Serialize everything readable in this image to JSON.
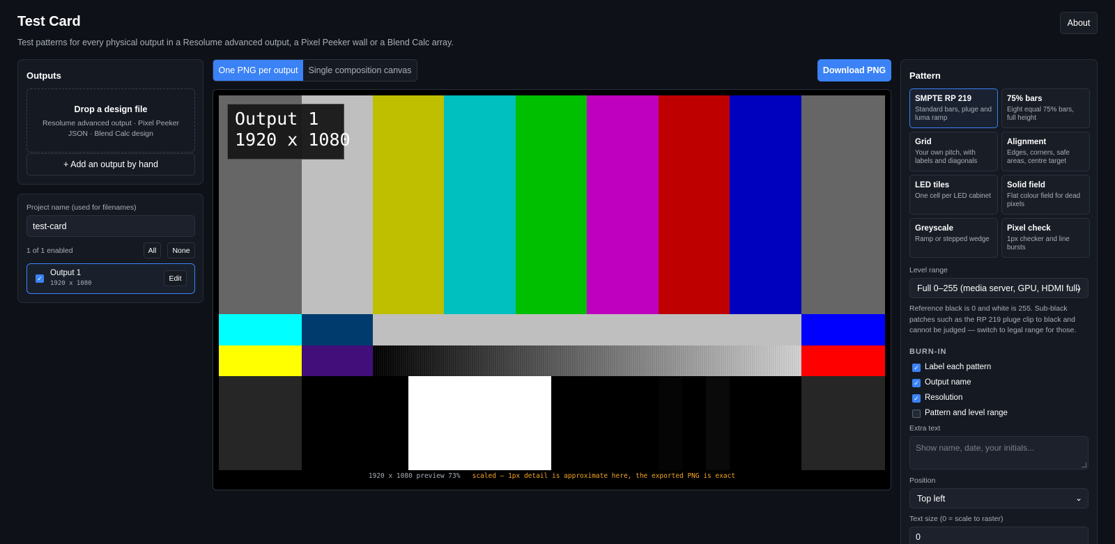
{
  "header": {
    "title": "Test Card",
    "subtitle": "Test patterns for every physical output in a Resolume advanced output, a Pixel Peeker wall or a Blend Calc array.",
    "about_label": "About"
  },
  "outputs_panel": {
    "title": "Outputs",
    "drop_title": "Drop a design file",
    "drop_subtitle": "Resolume advanced output · Pixel Peeker JSON · Blend Calc design",
    "add_label": "+ Add an output by hand"
  },
  "project": {
    "name_label": "Project name (used for filenames)",
    "name_value": "test-card",
    "enabled_count": "1 of 1 enabled",
    "all_label": "All",
    "none_label": "None",
    "outputs": [
      {
        "name": "Output 1",
        "resolution": "1920 x 1080",
        "checked": true,
        "edit_label": "Edit"
      }
    ]
  },
  "mode_tabs": [
    {
      "label": "One PNG per output",
      "active": true
    },
    {
      "label": "Single composition canvas",
      "active": false
    }
  ],
  "download_label": "Download PNG",
  "preview": {
    "overlay_line1": "Output 1",
    "overlay_line2": "1920 x 1080",
    "caption_info": "1920 x 1080  preview 73%",
    "caption_warning": "scaled — 1px detail is approximate here, the exported PNG is exact",
    "colors": {
      "grey": "#666666",
      "white75": "#bfbfbf",
      "yellow": "#bfbf00",
      "cyan": "#00bfbf",
      "green": "#00bf00",
      "magenta": "#bf00bf",
      "red": "#bf0000",
      "blue": "#0000bf"
    }
  },
  "pattern_panel": {
    "title": "Pattern",
    "patterns": [
      {
        "title": "SMPTE RP 219",
        "desc": "Standard bars, pluge and luma ramp",
        "active": true
      },
      {
        "title": "75% bars",
        "desc": "Eight equal 75% bars, full height",
        "active": false
      },
      {
        "title": "Grid",
        "desc": "Your own pitch, with labels and diagonals",
        "active": false
      },
      {
        "title": "Alignment",
        "desc": "Edges, corners, safe areas, centre target",
        "active": false
      },
      {
        "title": "LED tiles",
        "desc": "One cell per LED cabinet",
        "active": false
      },
      {
        "title": "Solid field",
        "desc": "Flat colour field for dead pixels",
        "active": false
      },
      {
        "title": "Greyscale",
        "desc": "Ramp or stepped wedge",
        "active": false
      },
      {
        "title": "Pixel check",
        "desc": "1px checker and line bursts",
        "active": false
      }
    ],
    "level_range_label": "Level range",
    "level_range_value": "Full 0–255 (media server, GPU, HDMI full)",
    "level_note": "Reference black is 0 and white is 255. Sub-black patches such as the RP 219 pluge clip to black and cannot be judged — switch to legal range for those.",
    "burnin_heading": "BURN-IN",
    "burnin_options": [
      {
        "label": "Label each pattern",
        "checked": true
      },
      {
        "label": "Output name",
        "checked": true
      },
      {
        "label": "Resolution",
        "checked": true
      },
      {
        "label": "Pattern and level range",
        "checked": false
      }
    ],
    "extra_text_label": "Extra text",
    "extra_text_placeholder": "Show name, date, your initials...",
    "position_label": "Position",
    "position_value": "Top left",
    "text_size_label": "Text size (0 = scale to raster)",
    "text_size_value": "0"
  }
}
